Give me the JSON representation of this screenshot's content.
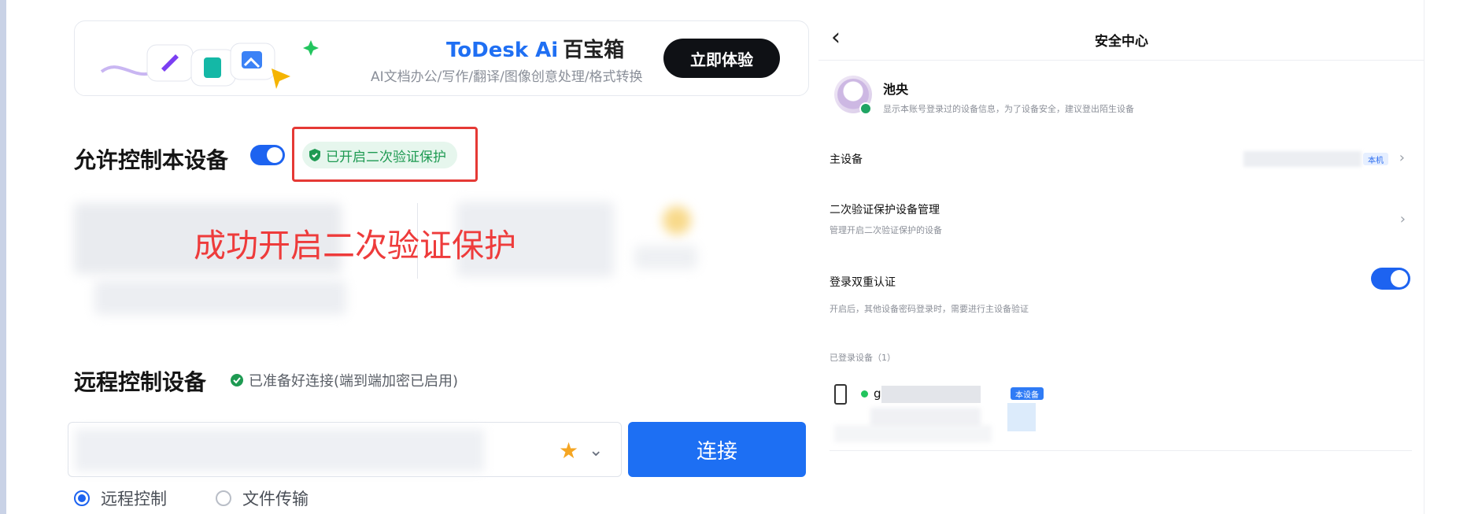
{
  "banner": {
    "brand": "ToDesk Ai",
    "title_cn": "百宝箱",
    "subtitle": "AI文档办公/写作/翻译/图像创意处理/格式转换",
    "cta": "立即体验"
  },
  "allow_control": {
    "title": "允许控制本设备",
    "toggle_on": true,
    "badge": "已开启二次验证保护"
  },
  "annotation": "成功开启二次验证保护",
  "remote_control": {
    "title": "远程控制设备",
    "status": "已准备好连接(端到端加密已启用)",
    "connect_label": "连接",
    "modes": [
      {
        "label": "远程控制",
        "checked": true
      },
      {
        "label": "文件传输",
        "checked": false
      }
    ]
  },
  "security_center": {
    "title": "安全中心",
    "user": {
      "name": "池央",
      "desc": "显示本账号登录过的设备信息，为了设备安全，建议登出陌生设备"
    },
    "main_device": {
      "label": "主设备",
      "tag": "本机"
    },
    "two_factor_devices": {
      "label": "二次验证保护设备管理",
      "sub": "管理开启二次验证保护的设备"
    },
    "dual_auth": {
      "label": "登录双重认证",
      "sub": "开启后，其他设备密码登录时，需要进行主设备验证",
      "toggle_on": true
    },
    "logged_devices": {
      "label": "已登录设备（1）",
      "device_name": "g",
      "device_tag": "本设备"
    }
  },
  "colors": {
    "accent": "#1d63f0",
    "success": "#1e9a52",
    "annotation_red": "#ee3b3b"
  }
}
